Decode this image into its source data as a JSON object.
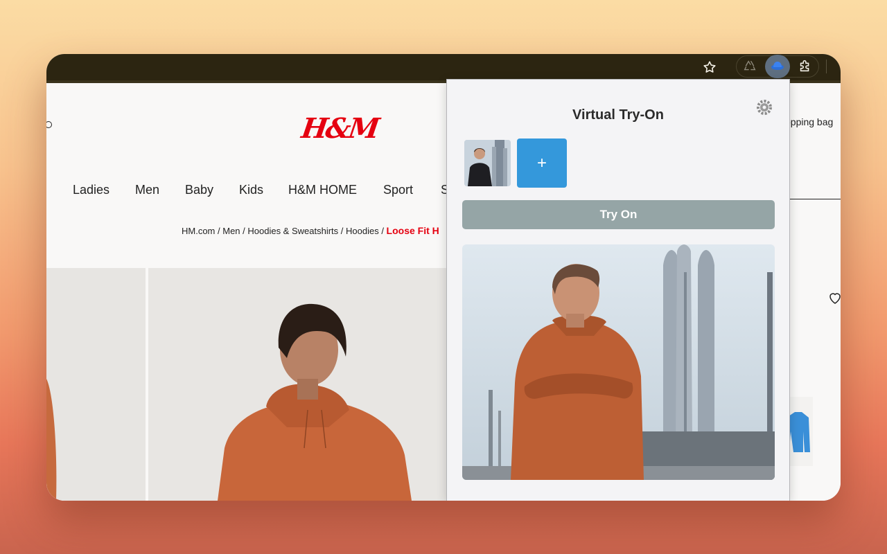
{
  "browser": {
    "toolbar_icons": [
      "star-icon",
      "recycle-icon",
      "hat-icon",
      "puzzle-icon"
    ]
  },
  "page": {
    "brand": "H&M",
    "shopping_bag": "opping bag",
    "nav": [
      "Ladies",
      "Men",
      "Baby",
      "Kids",
      "H&M HOME",
      "Sport",
      "S"
    ],
    "breadcrumb": {
      "items": [
        "HM.com",
        "Men",
        "Hoodies & Sweatshirts",
        "Hoodies"
      ],
      "current": "Loose Fit H"
    }
  },
  "popup": {
    "title": "Virtual Try-On",
    "add_label": "+",
    "try_on_label": "Try On"
  },
  "colors": {
    "brand_red": "#e50010",
    "add_button": "#3498db",
    "try_on_button": "#95a5a6"
  }
}
